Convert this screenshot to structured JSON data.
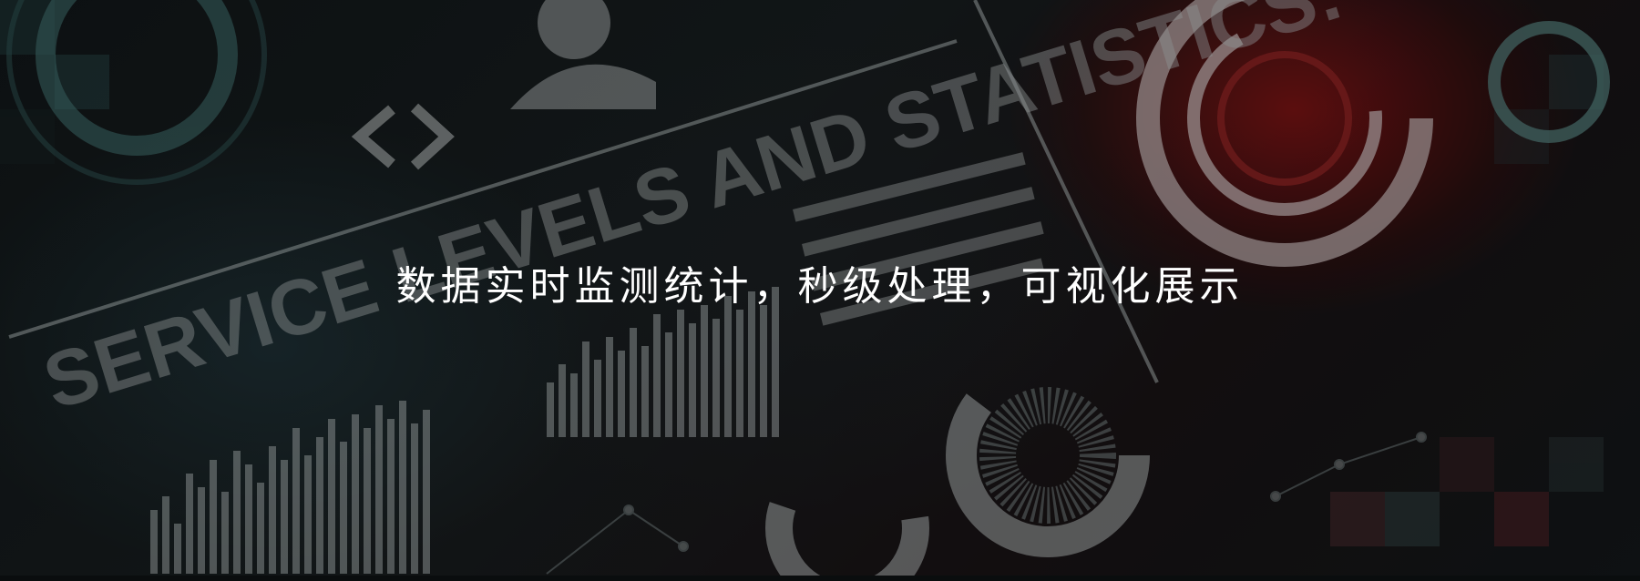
{
  "banner": {
    "headline": "数据实时监测统计，秒级处理，可视化展示",
    "background_text": "SERVICE LEVELS AND STATISTICS:",
    "background_icons": [
      "code-brackets-icon",
      "user-silhouette-icon",
      "people-grid-icon",
      "donut-chart-icon",
      "ring-gauge-icon"
    ],
    "colors": {
      "accent_red": "#b01818",
      "teal": "#3f6b70",
      "text": "#ffffff"
    }
  }
}
